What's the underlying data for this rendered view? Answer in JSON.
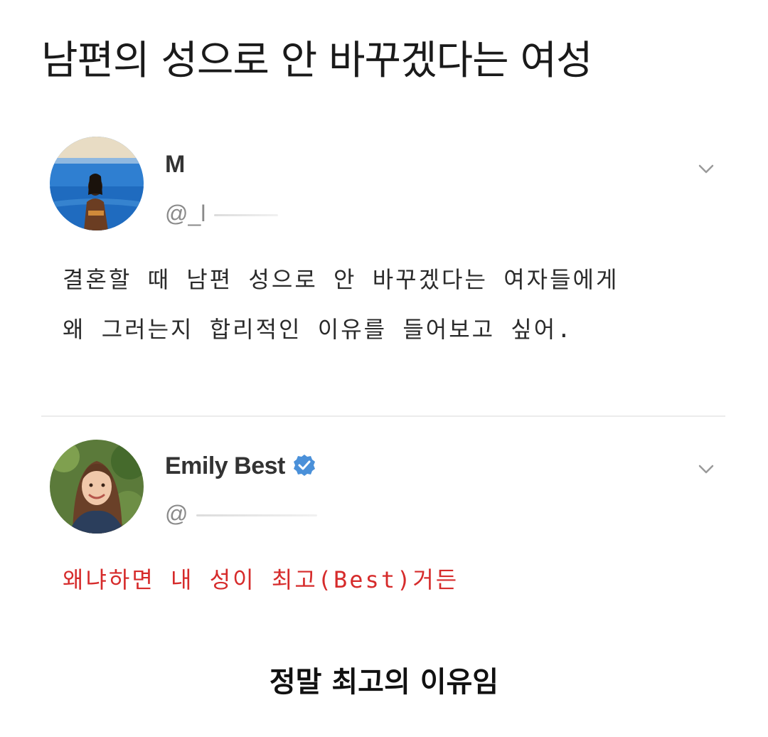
{
  "page": {
    "title": "남편의 성으로 안 바꾸겠다는 여성",
    "caption": "정말 최고의 이유임"
  },
  "tweets": [
    {
      "display_name": "M",
      "handle": "@_l",
      "verified": false,
      "text_lines": [
        "결혼할 때 남편 성으로 안 바꾸겠다는 여자들에게",
        "왜 그러는지 합리적인 이유를 들어보고 싶어."
      ],
      "icons": {
        "avatar": "avatar-photo-woman-by-pool",
        "menu": "chevron-down-icon"
      }
    },
    {
      "display_name": "Emily Best",
      "handle": "@",
      "verified": true,
      "text_lines": [
        "왜냐하면 내 성이 최고(Best)거든"
      ],
      "text_color": "#d62b2b",
      "icons": {
        "avatar": "avatar-photo-woman-smiling",
        "badge": "verified-badge-icon",
        "menu": "chevron-down-icon"
      }
    }
  ],
  "colors": {
    "verified_blue": "#4a90d9",
    "reply_red": "#d62b2b",
    "handle_gray": "#8a8a8a"
  }
}
